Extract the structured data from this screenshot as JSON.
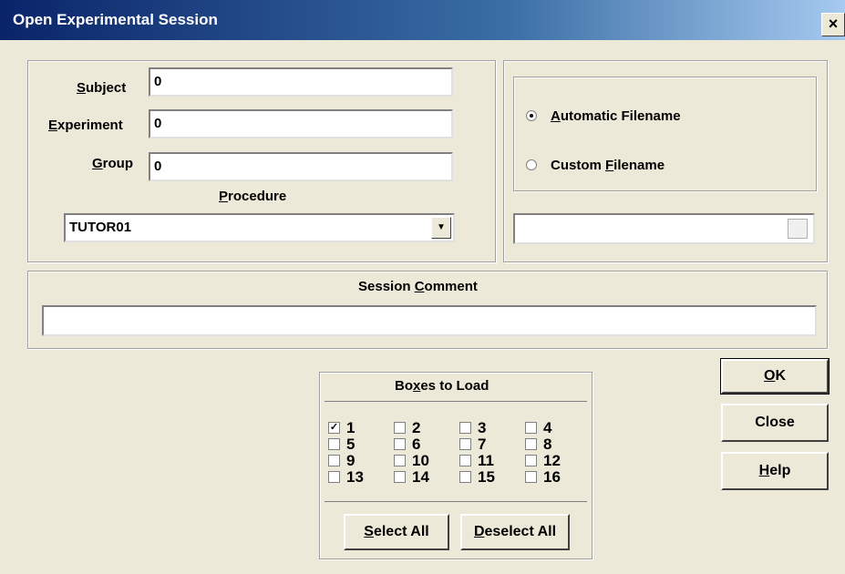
{
  "window": {
    "title": "Open Experimental Session",
    "close_glyph": "×"
  },
  "fields": {
    "subject": {
      "label_key": "S",
      "label_rest": "ubject",
      "value": "0"
    },
    "experiment": {
      "label_key": "E",
      "label_rest": "xperiment",
      "value": "0"
    },
    "group": {
      "label_key": "G",
      "label_rest": "roup",
      "value": "0"
    },
    "procedure": {
      "label_key": "P",
      "label_rest": "rocedure",
      "value": "TUTOR01"
    }
  },
  "filename": {
    "automatic": {
      "label_key": "A",
      "label_rest": "utomatic Filename",
      "selected": true
    },
    "custom": {
      "label_pre": "Custom ",
      "label_key": "F",
      "label_rest": "ilename",
      "selected": false
    },
    "path_value": ""
  },
  "comment": {
    "label_pre": "Session ",
    "label_key": "C",
    "label_rest": "omment",
    "value": ""
  },
  "boxes": {
    "title_pre": "Bo",
    "title_key": "x",
    "title_rest": "es to Load",
    "items": [
      {
        "label": "1",
        "checked": true
      },
      {
        "label": "2",
        "checked": false
      },
      {
        "label": "3",
        "checked": false
      },
      {
        "label": "4",
        "checked": false
      },
      {
        "label": "5",
        "checked": false
      },
      {
        "label": "6",
        "checked": false
      },
      {
        "label": "7",
        "checked": false
      },
      {
        "label": "8",
        "checked": false
      },
      {
        "label": "9",
        "checked": false
      },
      {
        "label": "10",
        "checked": false
      },
      {
        "label": "11",
        "checked": false
      },
      {
        "label": "12",
        "checked": false
      },
      {
        "label": "13",
        "checked": false
      },
      {
        "label": "14",
        "checked": false
      },
      {
        "label": "15",
        "checked": false
      },
      {
        "label": "16",
        "checked": false
      }
    ],
    "select_all": {
      "key": "S",
      "rest": "elect All"
    },
    "deselect_all": {
      "key": "D",
      "rest": "eselect All"
    }
  },
  "buttons": {
    "ok": {
      "key": "O",
      "rest": "K"
    },
    "close": {
      "label": "Close"
    },
    "help": {
      "key": "H",
      "rest": "elp"
    }
  },
  "icons": {
    "check_glyph": "✓",
    "dropdown": "dropdown-arrow-icon",
    "browse": "folder-browse-icon"
  }
}
